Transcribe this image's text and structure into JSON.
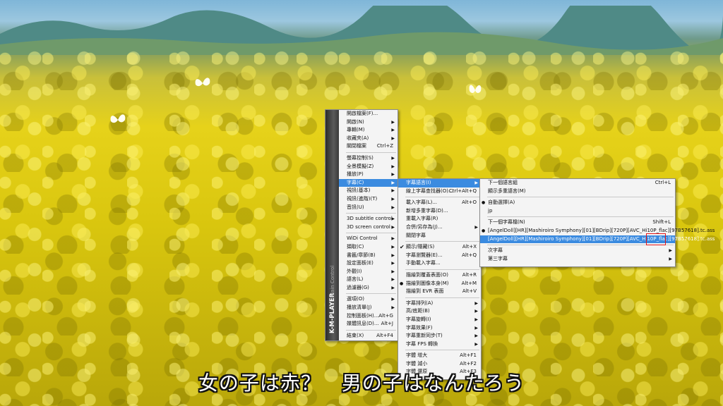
{
  "subtitle": "女の子は赤？　男の子はなんたろう",
  "sidebar": {
    "brand": "K-M-PLAYER",
    "sub": "Main Control"
  },
  "main_menu": {
    "items": [
      {
        "label": "開啟檔案(F)...",
        "shortcut": "",
        "submenu": false
      },
      {
        "label": "開啟(N)",
        "shortcut": "",
        "submenu": true
      },
      {
        "label": "專輯(M)",
        "shortcut": "",
        "submenu": true
      },
      {
        "label": "收藏夾(A)",
        "shortcut": "",
        "submenu": true
      },
      {
        "label": "關閉檔案",
        "shortcut": "Ctrl+Z",
        "submenu": false
      },
      {
        "sep": true
      },
      {
        "label": "螢幕控制(S)",
        "shortcut": "",
        "submenu": true
      },
      {
        "label": "全景模擬(Z)",
        "shortcut": "",
        "submenu": true
      },
      {
        "label": "播放(P)",
        "shortcut": "",
        "submenu": true
      },
      {
        "label": "字幕(C)",
        "shortcut": "",
        "submenu": true,
        "highlighted": true
      },
      {
        "label": "視訊(基本)",
        "shortcut": "",
        "submenu": true
      },
      {
        "label": "視訊(進階)(T)",
        "shortcut": "",
        "submenu": true
      },
      {
        "label": "音訊(U)",
        "shortcut": "",
        "submenu": true
      },
      {
        "sep": true
      },
      {
        "label": "3D subtitle control",
        "shortcut": "",
        "submenu": true
      },
      {
        "label": "3D screen control",
        "shortcut": "",
        "submenu": true
      },
      {
        "sep": true
      },
      {
        "label": "WiDi Control",
        "shortcut": "",
        "submenu": true
      },
      {
        "label": "擷取(C)",
        "shortcut": "",
        "submenu": true
      },
      {
        "label": "書籤/章節(B)",
        "shortcut": "",
        "submenu": true
      },
      {
        "label": "設定面板(E)",
        "shortcut": "",
        "submenu": true
      },
      {
        "label": "外觀(I)",
        "shortcut": "",
        "submenu": true
      },
      {
        "label": "語言(L)",
        "shortcut": "",
        "submenu": true
      },
      {
        "label": "過濾器(G)",
        "shortcut": "",
        "submenu": true
      },
      {
        "sep": true
      },
      {
        "label": "選項(O)",
        "shortcut": "",
        "submenu": true
      },
      {
        "label": "播放清單(J)",
        "shortcut": "",
        "submenu": true
      },
      {
        "label": "控制面板(H)...",
        "shortcut": "Alt+G",
        "submenu": false
      },
      {
        "label": "媒體訊息(D)...",
        "shortcut": "Alt+J",
        "submenu": false
      },
      {
        "sep": true
      },
      {
        "label": "結束(X)",
        "shortcut": "Alt+F4",
        "submenu": false
      }
    ]
  },
  "subtitle_menu": {
    "items": [
      {
        "label": "字幕語言(I)",
        "shortcut": "",
        "submenu": true,
        "highlighted": true
      },
      {
        "label": "線上字幕查找器(O)...",
        "shortcut": "Ctrl+Alt+Q",
        "submenu": false
      },
      {
        "sep": true
      },
      {
        "label": "載入字幕(L)...",
        "shortcut": "Alt+O",
        "submenu": false
      },
      {
        "label": "新增多重字幕(D)...",
        "shortcut": "",
        "submenu": false
      },
      {
        "label": "重載入字幕(R)",
        "shortcut": "",
        "submenu": false
      },
      {
        "label": "合併/另存為(J)...",
        "shortcut": "",
        "submenu": true
      },
      {
        "label": "關閉字幕",
        "shortcut": "",
        "submenu": false
      },
      {
        "sep": true
      },
      {
        "label": "顯示/隱藏(S)",
        "shortcut": "Alt+X",
        "submenu": false,
        "mark": "check"
      },
      {
        "label": "字幕瀏覽器(E)...",
        "shortcut": "Alt+Q",
        "submenu": false
      },
      {
        "label": "手動載入字幕...",
        "shortcut": "",
        "submenu": false
      },
      {
        "sep": true
      },
      {
        "label": "描繪到覆蓋表面(O)",
        "shortcut": "Alt+R",
        "submenu": false
      },
      {
        "label": "描繪到圖像本身(M)",
        "shortcut": "Alt+M",
        "submenu": false,
        "mark": "dot"
      },
      {
        "label": "描繪到 EVR 表面",
        "shortcut": "Alt+V",
        "submenu": false
      },
      {
        "sep": true
      },
      {
        "label": "字幕排列(A)",
        "shortcut": "",
        "submenu": true
      },
      {
        "label": "高/底距(B)",
        "shortcut": "",
        "submenu": true
      },
      {
        "label": "字幕旋轉(I)",
        "shortcut": "",
        "submenu": true
      },
      {
        "label": "字幕效果(F)",
        "shortcut": "",
        "submenu": true
      },
      {
        "label": "字幕重新同步(T)",
        "shortcut": "",
        "submenu": true
      },
      {
        "label": "字幕 FPS 轉換",
        "shortcut": "",
        "submenu": true
      },
      {
        "sep": true
      },
      {
        "label": "字體 增大",
        "shortcut": "Alt+F1",
        "submenu": false
      },
      {
        "label": "字體 減小",
        "shortcut": "Alt+F2",
        "submenu": false
      },
      {
        "label": "字體 還原",
        "shortcut": "Alt+F3",
        "submenu": false
      }
    ]
  },
  "language_menu": {
    "items": [
      {
        "label": "下一個語言組",
        "shortcut": "Ctrl+L",
        "submenu": false
      },
      {
        "label": "顯示多重語言(M)",
        "shortcut": "",
        "submenu": false
      },
      {
        "sep": true
      },
      {
        "label": "自動選擇(A)",
        "shortcut": "",
        "submenu": false,
        "mark": "dot"
      },
      {
        "label": "jp",
        "shortcut": "",
        "submenu": false
      },
      {
        "sep": true
      },
      {
        "label": "下一個字幕檔(N)",
        "shortcut": "Shift+L",
        "submenu": false
      },
      {
        "label": "[AngelDoll][HR][Mashiroiro Symphony][01][BDrip][720P][AVC_Hi10P_flac][97B57618].tc.ass",
        "shortcut": "",
        "submenu": false,
        "mark": "dot"
      },
      {
        "label": "[AngelDoll][HR][Mashiroiro Symphony][01][BDrip][720P][AVC_Hi10P_flac][97B57618].tc.ass",
        "shortcut": "",
        "submenu": false,
        "highlighted": true
      },
      {
        "sep": true
      },
      {
        "label": "次字幕",
        "shortcut": "",
        "submenu": true
      },
      {
        "label": "第三字幕",
        "shortcut": "",
        "submenu": true
      }
    ]
  },
  "colors": {
    "highlight": "#3b8be0",
    "menu_bg": "#f4f4f4",
    "annotation": "#e0161a"
  },
  "icons": {
    "submenu": "triangle-right",
    "check": "check-mark",
    "radio": "bullet-dot"
  }
}
